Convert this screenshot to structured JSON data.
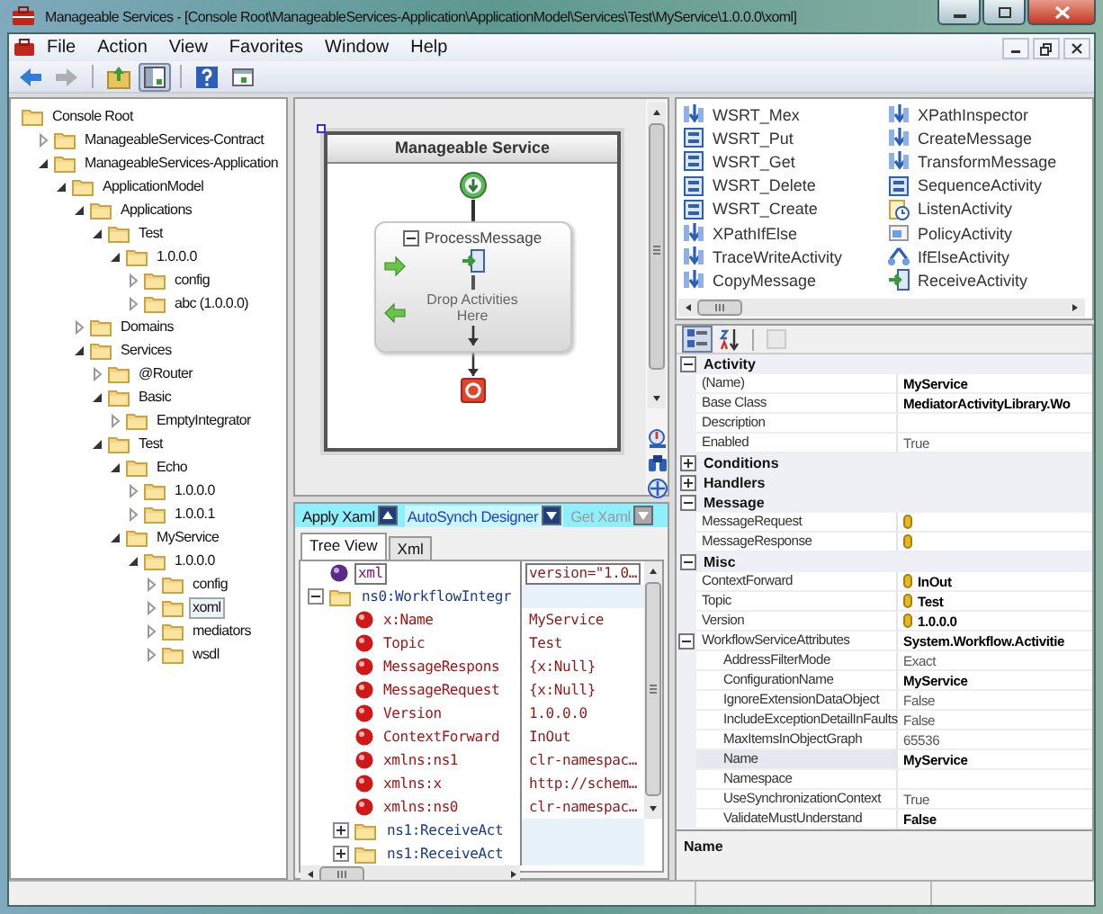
{
  "window": {
    "title": "Manageable Services - [Console Root\\ManageableServices-Application\\ApplicationModel\\Services\\Test\\MyService\\1.0.0.0\\xoml]"
  },
  "menu": {
    "items": [
      "File",
      "Action",
      "View",
      "Favorites",
      "Window",
      "Help"
    ]
  },
  "toolbar": [
    {
      "kind": "back",
      "disabled": false,
      "pressed": false
    },
    {
      "kind": "forward",
      "disabled": true,
      "pressed": false
    },
    {
      "kind": "up",
      "disabled": false,
      "pressed": false
    },
    {
      "kind": "console_tree",
      "disabled": false,
      "pressed": true
    },
    {
      "kind": "help",
      "disabled": false,
      "pressed": false
    },
    {
      "kind": "action_pane",
      "disabled": false,
      "pressed": false
    }
  ],
  "tree": [
    {
      "label": "Console Root",
      "selected": false,
      "children": [
        {
          "label": "ManageableServices-Contract",
          "expanded": false,
          "selected": false
        },
        {
          "label": "ManageableServices-Application",
          "expanded": true,
          "selected": false,
          "children": [
            {
              "label": "ApplicationModel",
              "expanded": true,
              "selected": false,
              "children": [
                {
                  "label": "Applications",
                  "expanded": true,
                  "selected": false,
                  "children": [
                    {
                      "label": "Test",
                      "expanded": true,
                      "selected": false,
                      "children": [
                        {
                          "label": "1.0.0.0",
                          "expanded": true,
                          "selected": false,
                          "children": [
                            {
                              "label": "config",
                              "expanded": false,
                              "selected": false
                            },
                            {
                              "label": "abc (1.0.0.0)",
                              "expanded": false,
                              "selected": false
                            }
                          ]
                        }
                      ]
                    }
                  ]
                },
                {
                  "label": "Domains",
                  "expanded": false,
                  "selected": false
                },
                {
                  "label": "Services",
                  "expanded": true,
                  "selected": false,
                  "children": [
                    {
                      "label": "@Router",
                      "expanded": false,
                      "selected": false
                    },
                    {
                      "label": "Basic",
                      "expanded": true,
                      "selected": false,
                      "children": [
                        {
                          "label": "EmptyIntegrator",
                          "expanded": false,
                          "selected": false
                        }
                      ]
                    },
                    {
                      "label": "Test",
                      "expanded": true,
                      "selected": false,
                      "children": [
                        {
                          "label": "Echo",
                          "expanded": true,
                          "selected": false,
                          "children": [
                            {
                              "label": "1.0.0.0",
                              "expanded": false,
                              "selected": false
                            },
                            {
                              "label": "1.0.0.1",
                              "expanded": false,
                              "selected": false
                            }
                          ]
                        },
                        {
                          "label": "MyService",
                          "expanded": true,
                          "selected": false,
                          "children": [
                            {
                              "label": "1.0.0.0",
                              "expanded": true,
                              "selected": false,
                              "children": [
                                {
                                  "label": "config",
                                  "expanded": false,
                                  "selected": false
                                },
                                {
                                  "label": "xoml",
                                  "expanded": false,
                                  "selected": true
                                },
                                {
                                  "label": "mediators",
                                  "expanded": false,
                                  "selected": false
                                },
                                {
                                  "label": "wsdl",
                                  "expanded": false,
                                  "selected": false
                                }
                              ]
                            }
                          ]
                        }
                      ]
                    }
                  ]
                }
              ]
            }
          ]
        }
      ]
    }
  ],
  "designer": {
    "title": "Manageable Service",
    "activity": {
      "title": "ProcessMessage",
      "expanded": true,
      "drop_hint": "Drop Activities Here"
    }
  },
  "xml_panel": {
    "toolbar": [
      {
        "label": "Apply Xaml",
        "kind": "up",
        "on": false,
        "disabled": false
      },
      {
        "label": "AutoSynch Designer",
        "kind": "down",
        "on": true,
        "disabled": false
      },
      {
        "label": "Get Xaml",
        "kind": "down",
        "on": false,
        "disabled": true
      }
    ],
    "tabs": [
      {
        "label": "Tree View",
        "selected": true
      },
      {
        "label": "Xml",
        "selected": false
      }
    ],
    "nodes": [
      {
        "kind": "declaration",
        "name": "xml",
        "value": "version=\"1.0…",
        "selected": true
      },
      {
        "kind": "element",
        "name": "ns0:WorkflowIntegr",
        "expanded": true,
        "selected": false,
        "children": [
          {
            "kind": "attribute",
            "name": "x:Name",
            "value": "MyService",
            "selected": false
          },
          {
            "kind": "attribute",
            "name": "Topic",
            "value": "Test",
            "selected": false
          },
          {
            "kind": "attribute",
            "name": "MessageRespons",
            "value": "{x:Null}",
            "selected": false
          },
          {
            "kind": "attribute",
            "name": "MessageRequest",
            "value": "{x:Null}",
            "selected": false
          },
          {
            "kind": "attribute",
            "name": "Version",
            "value": "1.0.0.0",
            "selected": false
          },
          {
            "kind": "attribute",
            "name": "ContextForward",
            "value": "InOut",
            "selected": false
          },
          {
            "kind": "attribute",
            "name": "xmlns:ns1",
            "value": "clr-namespac…",
            "selected": false
          },
          {
            "kind": "attribute",
            "name": "xmlns:x",
            "value": "http://schem…",
            "selected": false
          },
          {
            "kind": "attribute",
            "name": "xmlns:ns0",
            "value": "clr-namespac…",
            "selected": false
          },
          {
            "kind": "element",
            "name": "ns1:ReceiveAct",
            "expanded": false,
            "selected": false
          },
          {
            "kind": "element",
            "name": "ns1:ReceiveAct",
            "expanded": false,
            "selected": false
          }
        ]
      }
    ]
  },
  "toolbox": {
    "items": [
      {
        "label": "WSRT_Mex",
        "kind": "arrow"
      },
      {
        "label": "XPathInspector",
        "kind": "arrow"
      },
      {
        "label": "WSRT_Put",
        "kind": "box"
      },
      {
        "label": "CreateMessage",
        "kind": "arrow"
      },
      {
        "label": "WSRT_Get",
        "kind": "box"
      },
      {
        "label": "TransformMessage",
        "kind": "arrow"
      },
      {
        "label": "WSRT_Delete",
        "kind": "box"
      },
      {
        "label": "SequenceActivity",
        "kind": "box"
      },
      {
        "label": "WSRT_Create",
        "kind": "box"
      },
      {
        "label": "ListenActivity",
        "kind": "listen"
      },
      {
        "label": "XPathIfElse",
        "kind": "arrow"
      },
      {
        "label": "PolicyActivity",
        "kind": "policy"
      },
      {
        "label": "TraceWriteActivity",
        "kind": "arrow"
      },
      {
        "label": "IfElseActivity",
        "kind": "ifelse"
      },
      {
        "label": "CopyMessage",
        "kind": "arrow"
      },
      {
        "label": "ReceiveActivity",
        "kind": "receive"
      }
    ]
  },
  "property_grid": {
    "toolbar": [
      {
        "kind": "categorized",
        "selected": true,
        "disabled": false
      },
      {
        "kind": "alphabetical",
        "selected": false,
        "disabled": false
      },
      {
        "kind": "pages",
        "selected": false,
        "disabled": true
      }
    ],
    "categories": [
      {
        "name": "Activity",
        "expanded": true,
        "properties": [
          {
            "name": "(Name)",
            "value": "MyService",
            "bold": true,
            "bound": false,
            "selected": false
          },
          {
            "name": "Base Class",
            "value": "MediatorActivityLibrary.Wo",
            "bold": true,
            "bound": false,
            "selected": false
          },
          {
            "name": "Description",
            "bound": false,
            "selected": false
          },
          {
            "name": "Enabled",
            "value": "True",
            "bold": false,
            "bound": false,
            "selected": false
          }
        ]
      },
      {
        "name": "Conditions",
        "expanded": false
      },
      {
        "name": "Handlers",
        "expanded": false
      },
      {
        "name": "Message",
        "expanded": true,
        "properties": [
          {
            "name": "MessageRequest",
            "bound": true,
            "selected": false
          },
          {
            "name": "MessageResponse",
            "bound": true,
            "selected": false
          }
        ]
      },
      {
        "name": "Misc",
        "expanded": true,
        "properties": [
          {
            "name": "ContextForward",
            "value": "InOut",
            "bold": true,
            "bound": true,
            "selected": false
          },
          {
            "name": "Topic",
            "value": "Test",
            "bold": true,
            "bound": true,
            "selected": false
          },
          {
            "name": "Version",
            "value": "1.0.0.0",
            "bold": true,
            "bound": true,
            "selected": false
          },
          {
            "name": "WorkflowServiceAttributes",
            "value": "System.Workflow.Activitie",
            "bold": true,
            "bound": false,
            "selected": false,
            "expanded": true,
            "children": [
              {
                "name": "AddressFilterMode",
                "value": "Exact",
                "bold": false,
                "bound": false,
                "selected": false
              },
              {
                "name": "ConfigurationName",
                "value": "MyService",
                "bold": true,
                "bound": false,
                "selected": false
              },
              {
                "name": "IgnoreExtensionDataObject",
                "value": "False",
                "bold": false,
                "bound": false,
                "selected": false
              },
              {
                "name": "IncludeExceptionDetailInFaults",
                "value": "False",
                "bold": false,
                "bound": false,
                "selected": false
              },
              {
                "name": "MaxItemsInObjectGraph",
                "value": "65536",
                "bold": false,
                "bound": false,
                "selected": false
              },
              {
                "name": "Name",
                "value": "MyService",
                "bold": true,
                "bound": false,
                "selected": true
              },
              {
                "name": "Namespace",
                "bound": false,
                "selected": false
              },
              {
                "name": "UseSynchronizationContext",
                "value": "True",
                "bold": false,
                "bound": false,
                "selected": false
              },
              {
                "name": "ValidateMustUnderstand",
                "value": "False",
                "bold": true,
                "bound": false,
                "selected": false
              }
            ]
          }
        ]
      }
    ],
    "description": {
      "title": "Name"
    }
  }
}
